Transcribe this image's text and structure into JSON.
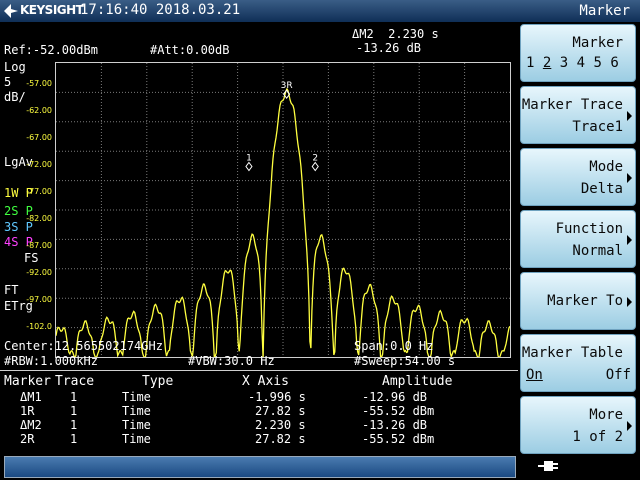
{
  "header": {
    "brand": "KEYSIGHT",
    "datetime": "17:16:40 2018.03.21"
  },
  "display": {
    "ref_level": "Ref:-52.00dBm",
    "attenuation": "#Att:0.00dB",
    "active_marker_label": "ΔM2  2.230 s",
    "active_marker_value": "-13.26 dB",
    "scale_type": "Log",
    "scale_per_div": "5",
    "scale_unit": "dB/",
    "detector": "LgAv",
    "traces": [
      {
        "label": "1W P",
        "color": "#ffff40"
      },
      {
        "label": "2S P",
        "color": "#40ff40"
      },
      {
        "label": "3S P",
        "color": "#60c8ff"
      },
      {
        "label": "4S P",
        "color": "#ff40ff"
      }
    ],
    "fs_label": "FS",
    "ft_label": "FT",
    "etrg_label": "ETrg",
    "y_ticks": [
      "-57.00",
      "-62.00",
      "-67.00",
      "-72.00",
      "-77.00",
      "-82.00",
      "-87.00",
      "-92.00",
      "-97.00",
      "-102.0"
    ],
    "center": "Center:12.565502174GHz",
    "span": "Span:0.0 Hz",
    "rbw": "#RBW:1.000kHz",
    "vbw": "#VBW:30.0 Hz",
    "sweep": "#Sweep:54.00 s",
    "trace_color": "#ffff40"
  },
  "markers_on_plot": [
    {
      "label": "3R",
      "x": 0.508,
      "y": -57.3
    },
    {
      "label": "1",
      "x": 0.425,
      "y": -69.6
    },
    {
      "label": "2",
      "x": 0.571,
      "y": -69.6
    }
  ],
  "marker_table": {
    "headers": [
      "Marker",
      "Trace",
      "Type",
      "X Axis",
      "Amplitude"
    ],
    "rows": [
      {
        "marker": "ΔM1",
        "trace": "1",
        "type": "Time",
        "x": "-1.996 s",
        "amp": "-12.96 dB"
      },
      {
        "marker": "1R",
        "trace": "1",
        "type": "Time",
        "x": "27.82 s",
        "amp": "-55.52 dBm"
      },
      {
        "marker": "ΔM2",
        "trace": "1",
        "type": "Time",
        "x": "2.230 s",
        "amp": "-13.26 dB"
      },
      {
        "marker": "2R",
        "trace": "1",
        "type": "Time",
        "x": "27.82 s",
        "amp": "-55.52 dBm"
      }
    ]
  },
  "panel": {
    "title": "Marker",
    "keys": [
      {
        "line1": "Marker",
        "line2": "",
        "numbers": [
          "1",
          "2",
          "3",
          "4",
          "5",
          "6"
        ],
        "selected": "2"
      },
      {
        "line1": "Marker Trace",
        "line2": "Trace1",
        "arrow": true
      },
      {
        "line1": "Mode",
        "line2": "Delta",
        "arrow": true
      },
      {
        "line1": "Function",
        "line2": "Normal",
        "arrow": true
      },
      {
        "line1": "Marker To",
        "line2": "",
        "arrow": true
      },
      {
        "line1": "Marker Table",
        "on": "On",
        "off": "Off"
      },
      {
        "line1": "More",
        "line2": "1 of 2",
        "arrow": true
      }
    ]
  }
}
